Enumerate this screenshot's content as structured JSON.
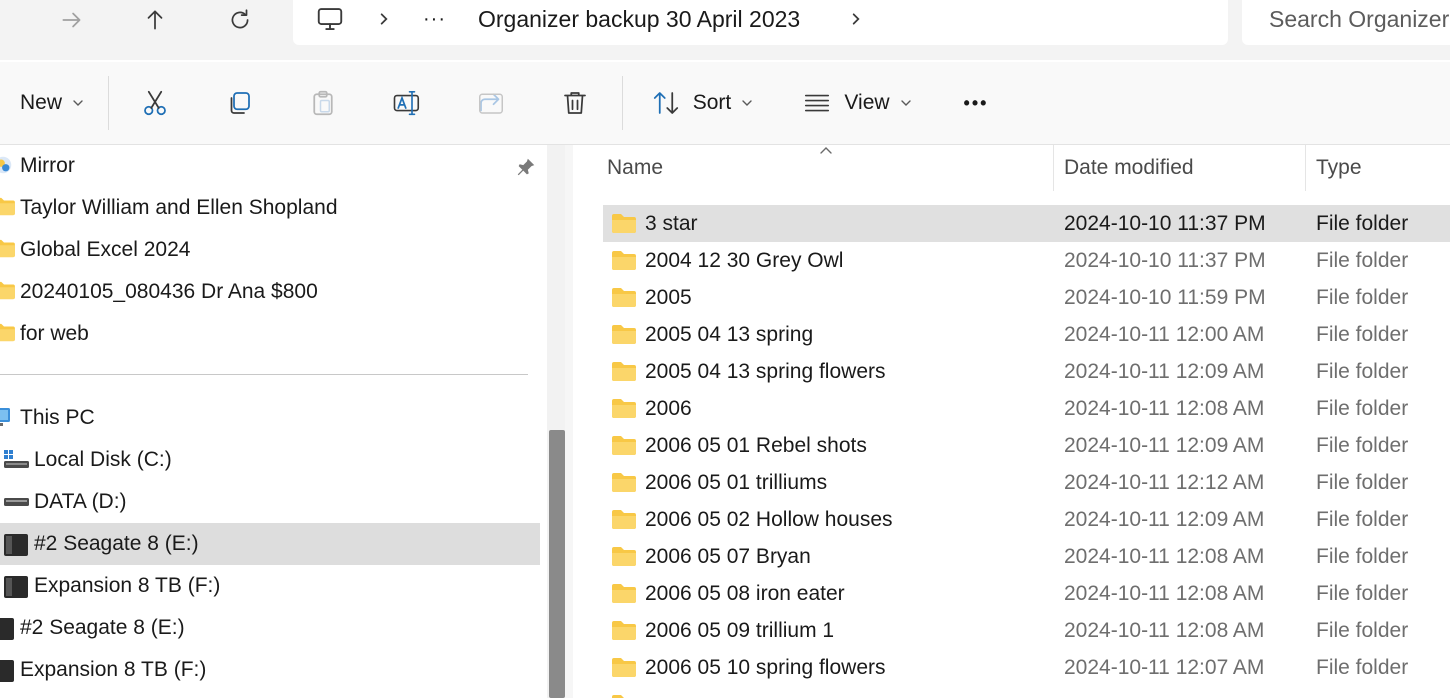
{
  "addressbar": {
    "path_label": "Organizer backup 30 April 2023",
    "overflow_label": "···",
    "search_placeholder": "Search Organizer"
  },
  "toolbar": {
    "new_label": "New",
    "sort_label": "Sort",
    "view_label": "View",
    "more_label": "•••"
  },
  "nav": {
    "quick_access": [
      {
        "label": "Mirror",
        "icon": "photos-icon"
      },
      {
        "label": "Taylor William and Ellen Shopland",
        "icon": "folder-icon"
      },
      {
        "label": "Global Excel 2024",
        "icon": "folder-icon"
      },
      {
        "label": "20240105_080436 Dr Ana $800",
        "icon": "folder-icon"
      },
      {
        "label": "for web",
        "icon": "folder-icon"
      }
    ],
    "devices": [
      {
        "label": "This PC",
        "icon": "monitor-icon"
      },
      {
        "label": "Local Disk (C:)",
        "icon": "windows-drive-icon"
      },
      {
        "label": "DATA (D:)",
        "icon": "drive-icon"
      },
      {
        "label": "#2 Seagate 8 (E:)",
        "icon": "external-drive-icon",
        "selected": true
      },
      {
        "label": "Expansion 8 TB (F:)",
        "icon": "external-drive-icon"
      },
      {
        "label": "#2 Seagate 8 (E:)",
        "icon": "external-drive-icon"
      },
      {
        "label": "Expansion 8 TB (F:)",
        "icon": "external-drive-icon"
      }
    ]
  },
  "filelist": {
    "columns": {
      "name": "Name",
      "date": "Date modified",
      "type": "Type"
    },
    "rows": [
      {
        "name": "3 star",
        "date": "2024-10-10 11:37 PM",
        "type": "File folder",
        "selected": true
      },
      {
        "name": "2004 12 30  Grey Owl",
        "date": "2024-10-10 11:37 PM",
        "type": "File folder"
      },
      {
        "name": "2005",
        "date": "2024-10-10 11:59 PM",
        "type": "File folder"
      },
      {
        "name": "2005 04 13 spring",
        "date": "2024-10-11 12:00 AM",
        "type": "File folder"
      },
      {
        "name": "2005 04 13 spring flowers",
        "date": "2024-10-11 12:09 AM",
        "type": "File folder"
      },
      {
        "name": "2006",
        "date": "2024-10-11 12:08 AM",
        "type": "File folder"
      },
      {
        "name": "2006 05 01 Rebel shots",
        "date": "2024-10-11 12:09 AM",
        "type": "File folder"
      },
      {
        "name": "2006 05 01 trilliums",
        "date": "2024-10-11 12:12 AM",
        "type": "File folder"
      },
      {
        "name": "2006 05 02 Hollow houses",
        "date": "2024-10-11 12:09 AM",
        "type": "File folder"
      },
      {
        "name": "2006 05 07 Bryan",
        "date": "2024-10-11 12:08 AM",
        "type": "File folder"
      },
      {
        "name": "2006 05 08 iron eater",
        "date": "2024-10-11 12:08 AM",
        "type": "File folder"
      },
      {
        "name": "2006 05 09 trillium 1",
        "date": "2024-10-11 12:08 AM",
        "type": "File folder"
      },
      {
        "name": "2006 05 10 spring flowers",
        "date": "2024-10-11 12:07 AM",
        "type": "File folder"
      }
    ]
  },
  "colors": {
    "folder": "#f8c846",
    "selection": "#e0e0e0",
    "accent": "#0067c0"
  }
}
